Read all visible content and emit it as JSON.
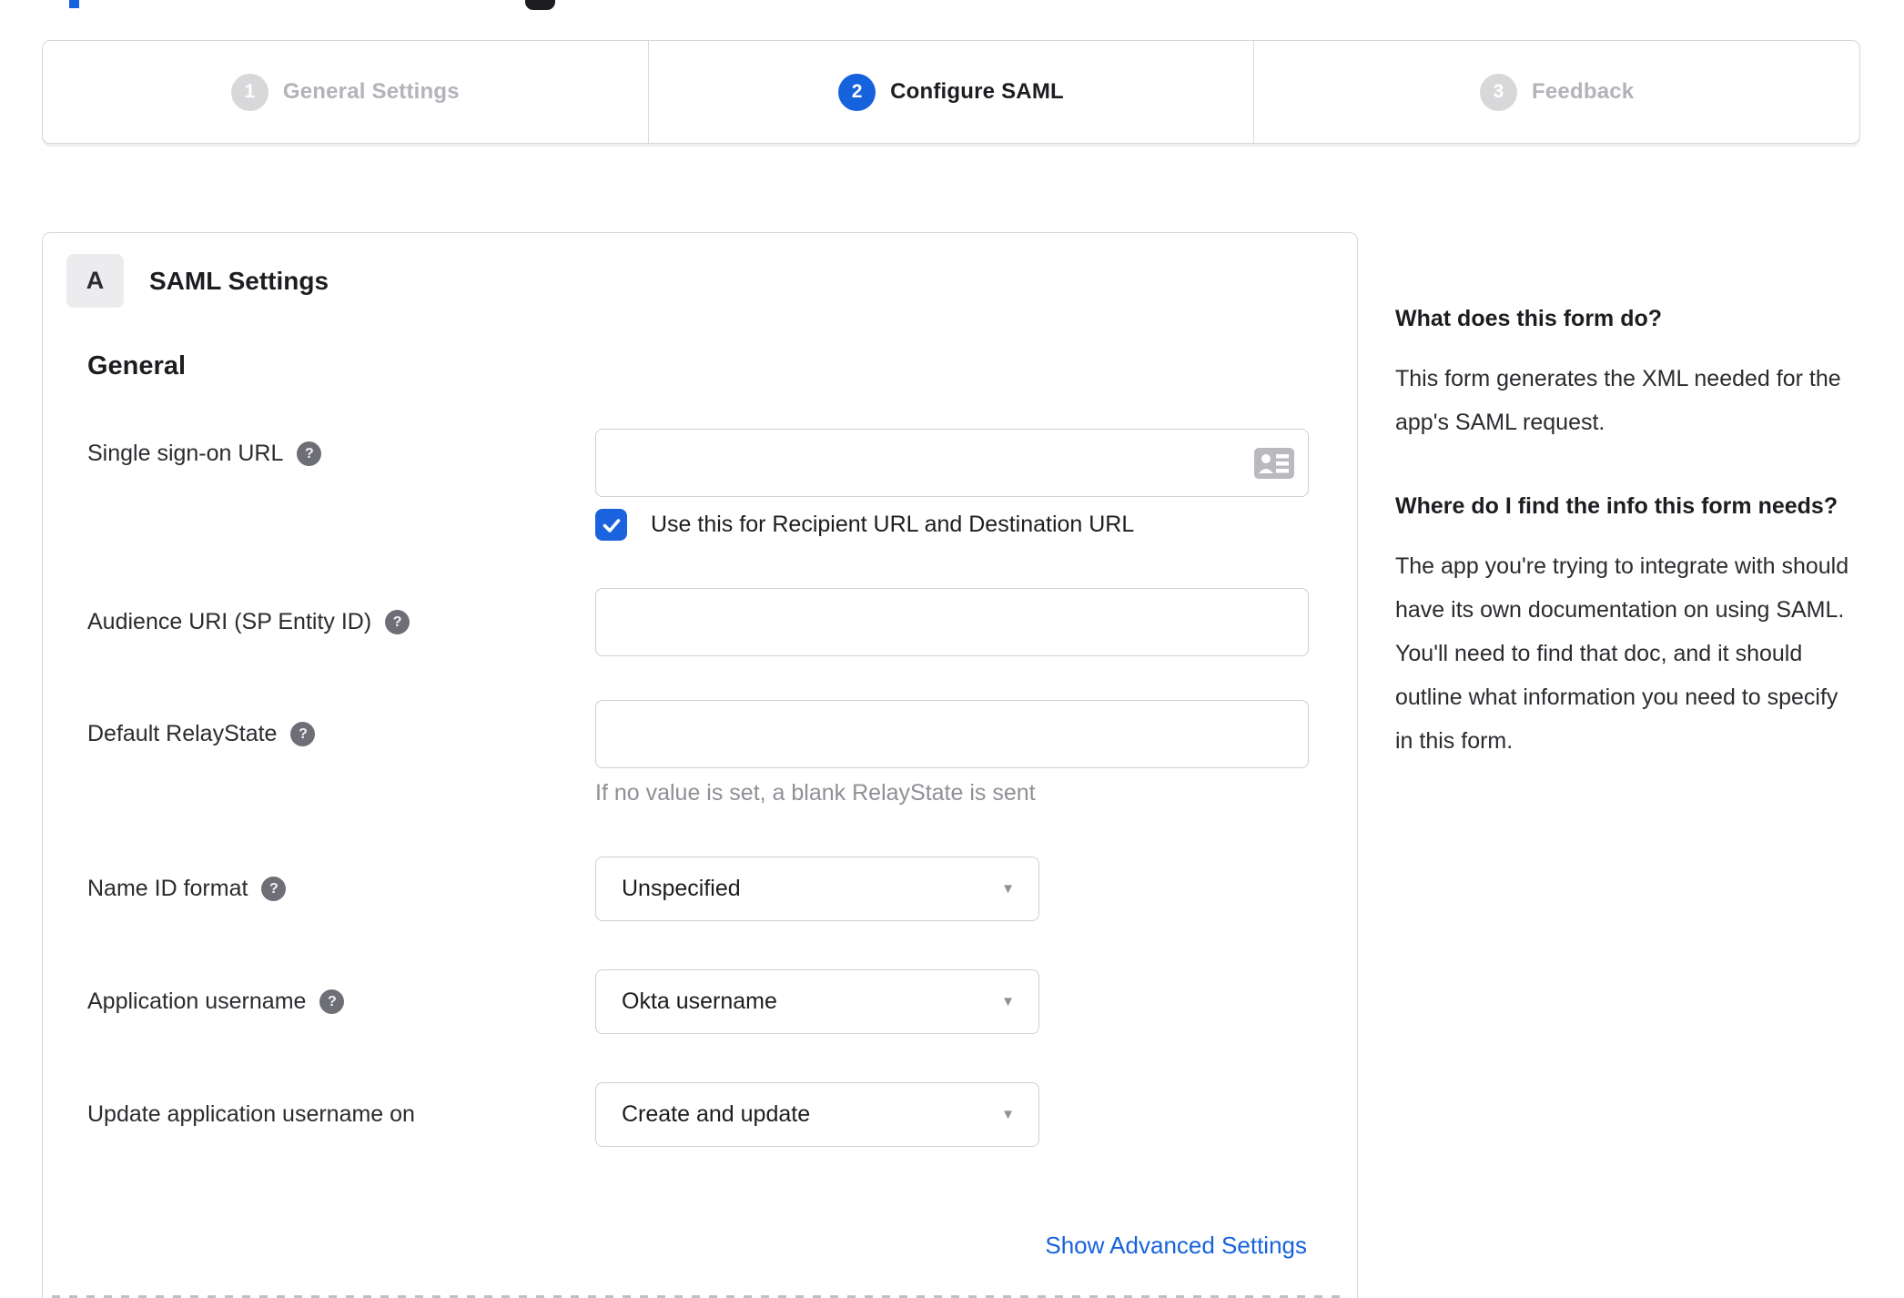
{
  "stepper": {
    "steps": [
      {
        "number": "1",
        "label": "General Settings",
        "state": "inactive"
      },
      {
        "number": "2",
        "label": "Configure SAML",
        "state": "active"
      },
      {
        "number": "3",
        "label": "Feedback",
        "state": "inactive"
      }
    ]
  },
  "panel": {
    "badge": "A",
    "title": "SAML Settings",
    "section_title": "General",
    "sso": {
      "label": "Single sign-on URL",
      "value": "",
      "checkbox_label": "Use this for Recipient URL and Destination URL",
      "checkbox_checked": true
    },
    "audience": {
      "label": "Audience URI (SP Entity ID)",
      "value": ""
    },
    "relay": {
      "label": "Default RelayState",
      "value": "",
      "hint": "If no value is set, a blank RelayState is sent"
    },
    "name_id": {
      "label": "Name ID format",
      "value": "Unspecified"
    },
    "app_user": {
      "label": "Application username",
      "value": "Okta username"
    },
    "update_user": {
      "label": "Update application username on",
      "value": "Create and update"
    },
    "advanced_link": "Show Advanced Settings"
  },
  "sidebar": {
    "q1_title": "What does this form do?",
    "q1_body": "This form generates the XML needed for the app's SAML request.",
    "q2_title": "Where do I find the info this form needs?",
    "q2_body": "The app you're trying to integrate with should have its own documentation on using SAML. You'll need to find that doc, and it should outline what information you need to specify in this form."
  },
  "colors": {
    "accent_blue": "#1662dd",
    "inactive_gray": "#d8d8db",
    "border_gray": "#d7d7db",
    "hint_gray": "#8f8f95"
  }
}
